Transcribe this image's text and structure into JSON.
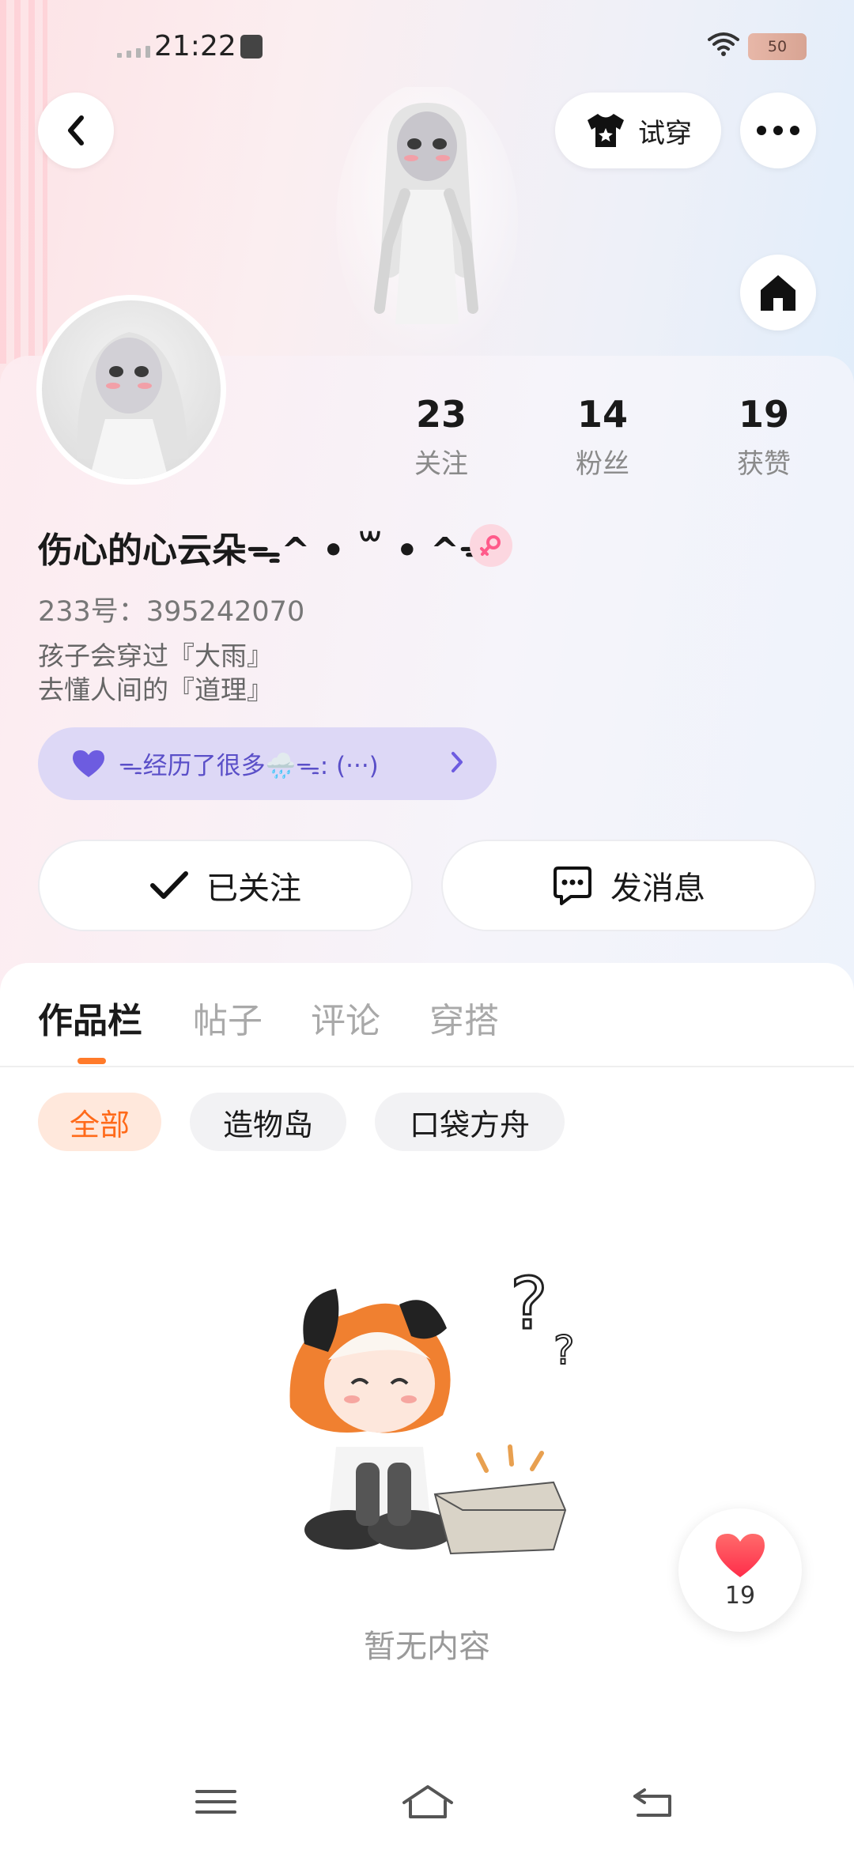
{
  "status_bar": {
    "time": "21:22",
    "battery": "50"
  },
  "header": {
    "try_on_label": "试穿"
  },
  "stats": [
    {
      "value": "23",
      "label": "关注"
    },
    {
      "value": "14",
      "label": "粉丝"
    },
    {
      "value": "19",
      "label": "获赞"
    }
  ],
  "profile": {
    "name": "伤心的心云朵ᯓ^ • ꒳ • ^ᯓ",
    "id_line": "233号：395242070",
    "bio_line1": "孩子会穿过『大雨』",
    "bio_line2": "去懂人间的『道理』",
    "mood": "ᯓ经历了很多🌧️ᯓ: (···)"
  },
  "actions": {
    "follow_label": "已关注",
    "message_label": "发消息"
  },
  "tabs": [
    "作品栏",
    "帖子",
    "评论",
    "穿搭"
  ],
  "filters": [
    "全部",
    "造物岛",
    "口袋方舟"
  ],
  "empty_state": {
    "text": "暂无内容"
  },
  "like_fab": {
    "count": "19"
  },
  "colors": {
    "accent": "#ff7a2a",
    "mood_bg": "#ddd8f6",
    "mood_text": "#5a4fc8",
    "heart": "#ff3b4e"
  }
}
